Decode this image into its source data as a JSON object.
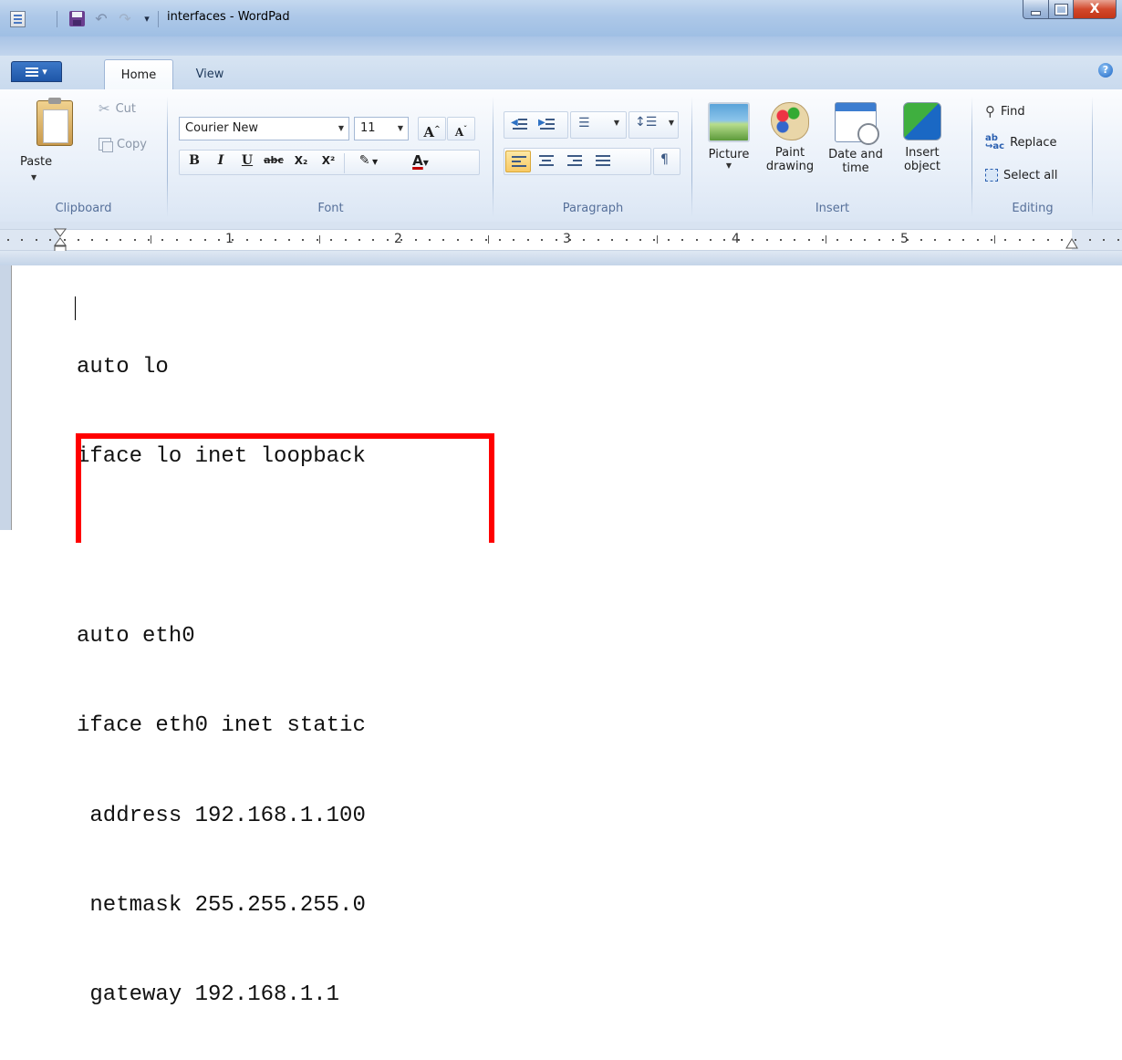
{
  "window": {
    "title": "interfaces - WordPad",
    "close_glyph": "X"
  },
  "tabs": [
    {
      "label": "Home"
    },
    {
      "label": "View"
    }
  ],
  "help_glyph": "?",
  "ribbon": {
    "clipboard": {
      "group_label": "Clipboard",
      "paste_label": "Paste",
      "cut_label": "Cut",
      "copy_label": "Copy"
    },
    "font": {
      "group_label": "Font",
      "font_family": "Courier New",
      "font_size": "11",
      "bold": "B",
      "italic": "I",
      "underline": "U",
      "strikethrough": "abc",
      "subscript": "X₂",
      "superscript": "X²",
      "text_color": "A"
    },
    "paragraph": {
      "group_label": "Paragraph"
    },
    "insert": {
      "group_label": "Insert",
      "picture_label": "Picture",
      "paint_label_line1": "Paint",
      "paint_label_line2": "drawing",
      "datetime_label_line1": "Date and",
      "datetime_label_line2": "time",
      "object_label_line1": "Insert",
      "object_label_line2": "object"
    },
    "editing": {
      "group_label": "Editing",
      "find_label": "Find",
      "replace_label": "Replace",
      "select_all_label": "Select all"
    }
  },
  "ruler": {
    "numbers": [
      "1",
      "2",
      "3",
      "4",
      "5"
    ]
  },
  "document": {
    "lines": [
      "auto lo",
      "iface lo inet loopback",
      "",
      "auto eth0",
      "iface eth0 inet static",
      " address 192.168.1.100",
      " netmask 255.255.255.0",
      " gateway 192.168.1.1"
    ]
  },
  "colors": {
    "highlight_box": "#ff0000",
    "close_button": "#d2492c",
    "ribbon_background": "#e9f0f9"
  }
}
